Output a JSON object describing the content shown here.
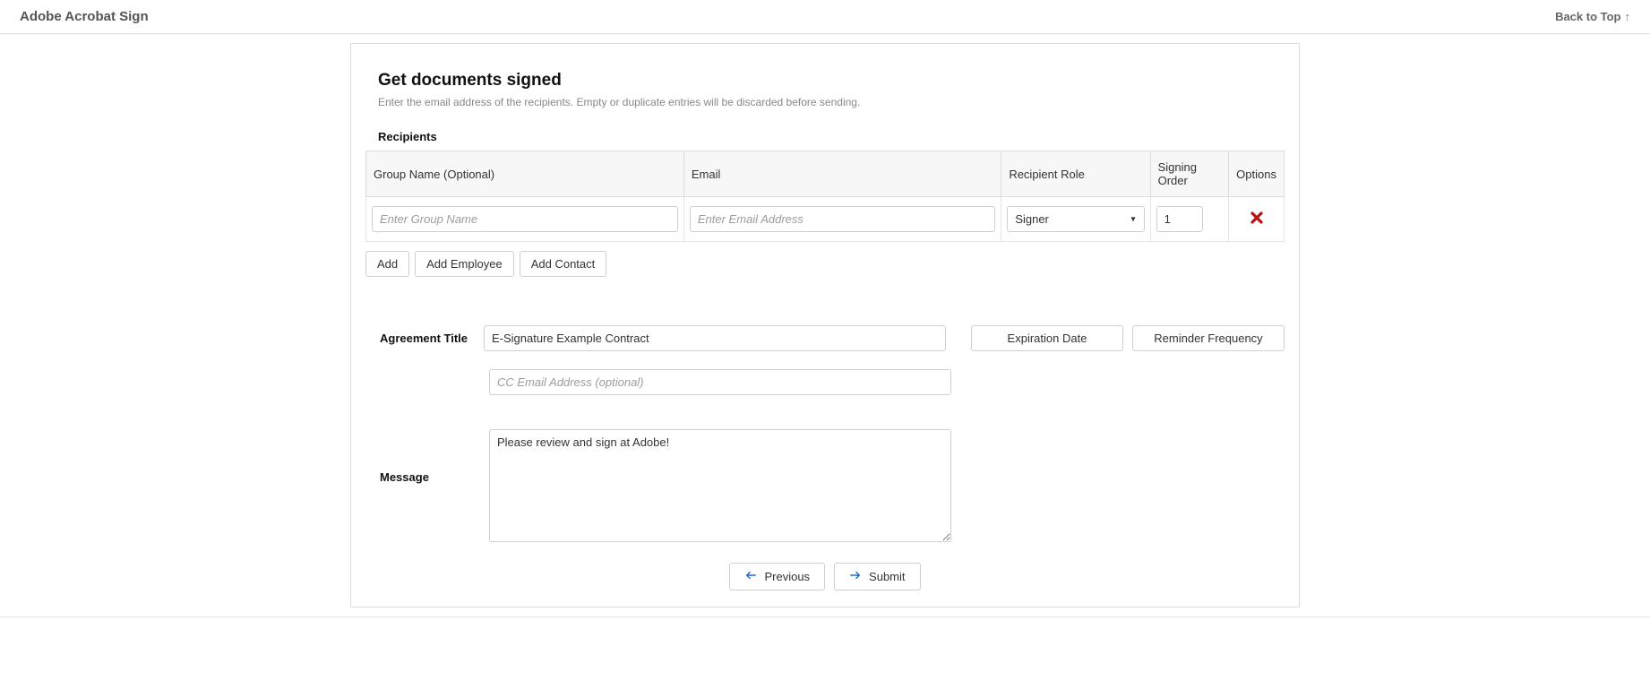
{
  "topbar": {
    "title": "Adobe Acrobat Sign",
    "back_to_top": "Back to Top"
  },
  "form": {
    "heading": "Get documents signed",
    "subheading": "Enter the email address of the recipients. Empty or duplicate entries will be discarded before sending.",
    "recipients_label": "Recipients",
    "columns": {
      "group": "Group Name (Optional)",
      "email": "Email",
      "role": "Recipient Role",
      "order": "Signing Order",
      "options": "Options"
    },
    "row": {
      "group_placeholder": "Enter Group Name",
      "email_placeholder": "Enter Email Address",
      "role_value": "Signer",
      "order_value": "1"
    },
    "buttons": {
      "add": "Add",
      "add_employee": "Add Employee",
      "add_contact": "Add Contact"
    },
    "agreement": {
      "title_label": "Agreement Title",
      "title_value": "E-Signature Example Contract",
      "cc_placeholder": "CC Email Address (optional)",
      "expiration_btn": "Expiration Date",
      "reminder_btn": "Reminder Frequency",
      "message_label": "Message",
      "message_value": "Please review and sign at Adobe!"
    },
    "nav": {
      "previous": "Previous",
      "submit": "Submit"
    }
  }
}
